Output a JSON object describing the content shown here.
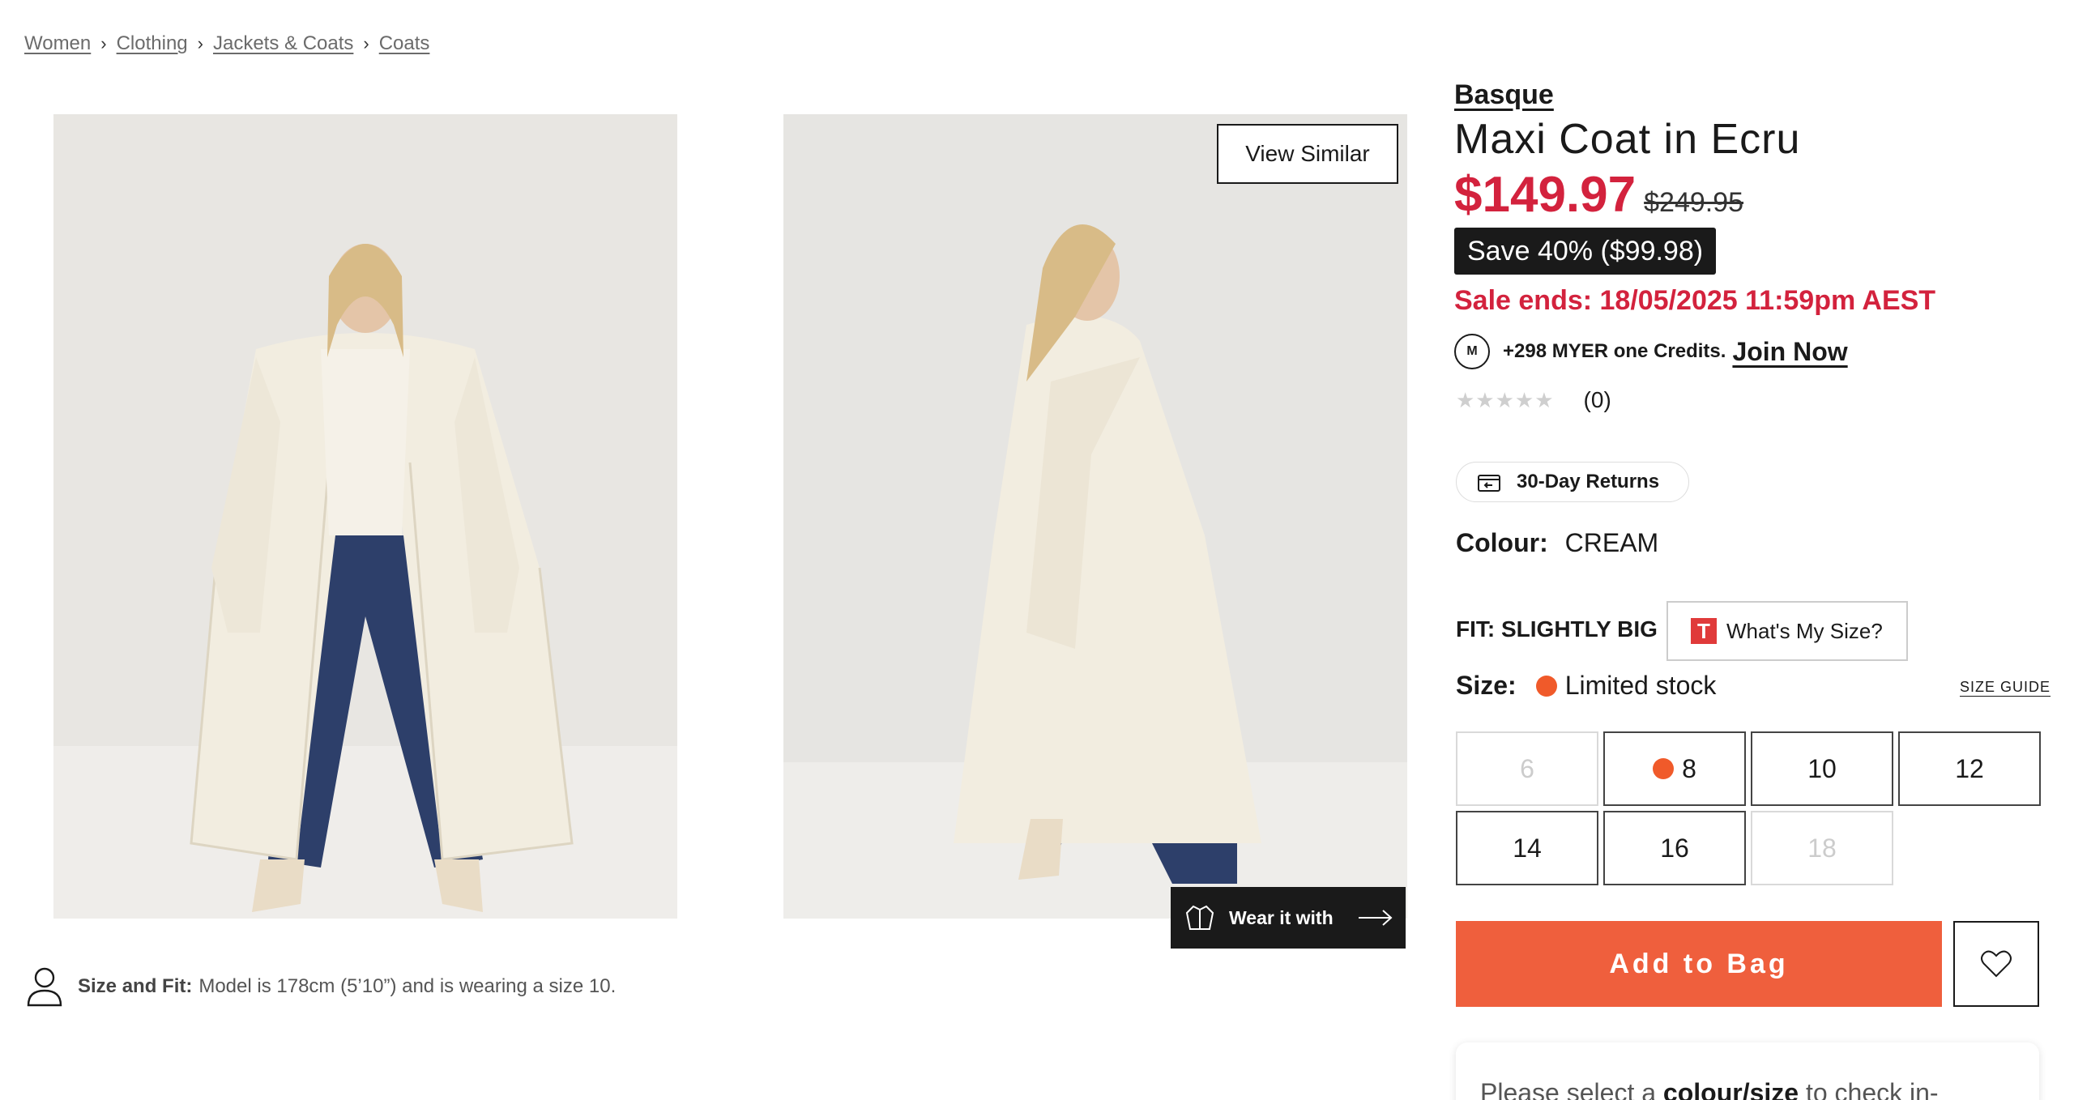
{
  "breadcrumb": [
    "Women",
    "Clothing",
    "Jackets & Coats",
    "Coats"
  ],
  "gallery": {
    "view_similar": "View Similar",
    "wear_it_with": "Wear it with",
    "size_and_fit_label": "Size and Fit:",
    "size_and_fit_text": "Model is 178cm (5’10”) and is wearing a size 10."
  },
  "product": {
    "brand": "Basque",
    "title": "Maxi Coat in Ecru",
    "price_now": "$149.97",
    "price_was": "$249.95",
    "save": "Save 40% ($99.98)",
    "sale_ends": "Sale ends: 18/05/2025 11:59pm AEST",
    "credits_text": "+298 MYER one Credits.",
    "join_now": "Join Now",
    "rating_count": "(0)",
    "returns": "30-Day Returns",
    "colour_label": "Colour:",
    "colour_value": "CREAM",
    "fit": "FIT: SLIGHTLY BIG",
    "whats_my_size": "What's My Size?",
    "size_label": "Size:",
    "limited_stock": "Limited stock",
    "size_guide": "SIZE GUIDE",
    "sizes": [
      {
        "label": "6",
        "state": "disabled"
      },
      {
        "label": "8",
        "state": "limited"
      },
      {
        "label": "10",
        "state": "available"
      },
      {
        "label": "12",
        "state": "available"
      },
      {
        "label": "14",
        "state": "available"
      },
      {
        "label": "16",
        "state": "available"
      },
      {
        "label": "18",
        "state": "disabled"
      }
    ],
    "add_to_bag": "Add to Bag",
    "stock_prefix": "Please select a",
    "stock_link": "colour/size",
    "stock_suffix": "to check in-"
  },
  "colors": {
    "sale_red": "#d3223d",
    "add_to_bag": "#ef5f3d",
    "limited_dot": "#f05a2a"
  },
  "icons": {
    "m_logo": "M",
    "star": "★",
    "chevron": "›"
  }
}
